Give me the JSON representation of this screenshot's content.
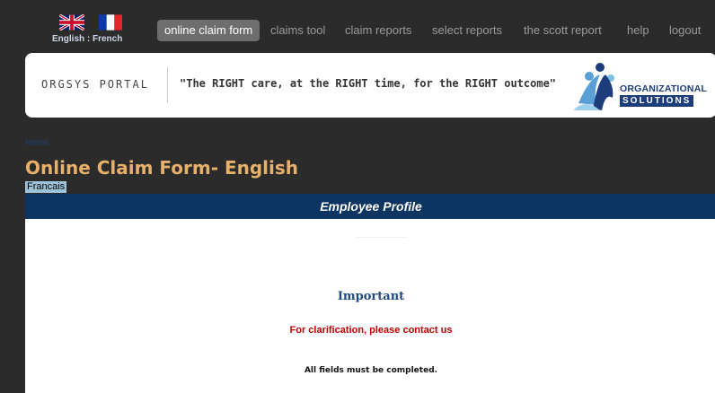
{
  "language_switch": {
    "label": "English : French",
    "icons": [
      "uk-flag-icon",
      "france-flag-icon"
    ]
  },
  "nav": {
    "items": [
      {
        "label": "online claim form",
        "active": true
      },
      {
        "label": "claims tool"
      },
      {
        "label": "claim reports"
      },
      {
        "label": "select reports"
      },
      {
        "label": "the scott report"
      },
      {
        "label": "help"
      },
      {
        "label": "logout"
      }
    ]
  },
  "banner": {
    "portal_label": "ORGSYS PORTAL",
    "tagline": "\"The RIGHT care, at the RIGHT time, for the RIGHT outcome\"",
    "logo_line1": "ORGANIZATIONAL",
    "logo_line2": "SOLUTIONS"
  },
  "page": {
    "back_link": "Home",
    "title": "Online Claim Form- English",
    "alt_language_link": "Francais"
  },
  "profile": {
    "section_title": "Employee Profile",
    "important_heading": "Important",
    "clarification_text": "For clarification, please contact us",
    "fields_note": "All fields must be completed."
  },
  "colors": {
    "background": "#2b2b2b",
    "title_accent": "#e7b16b",
    "section_bar": "#0c3563",
    "warning_red": "#c00000"
  }
}
